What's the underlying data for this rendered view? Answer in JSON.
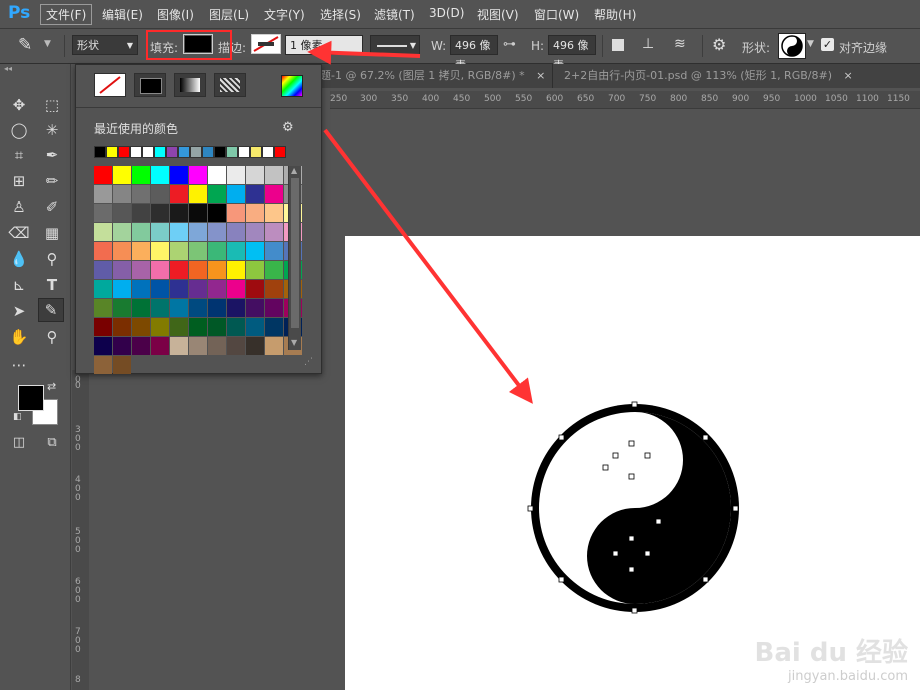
{
  "app": {
    "logo": "Ps"
  },
  "menu": [
    "文件(F)",
    "编辑(E)",
    "图像(I)",
    "图层(L)",
    "文字(Y)",
    "选择(S)",
    "滤镜(T)",
    "3D(D)",
    "视图(V)",
    "窗口(W)",
    "帮助(H)"
  ],
  "options": {
    "mode": "形状",
    "fill_label": "填充:",
    "fill_color": "#000000",
    "stroke_label": "描边:",
    "stroke_width": "1 像素",
    "w_label": "W:",
    "w_value": "496 像素",
    "h_label": "H:",
    "h_value": "496 像素",
    "shape_label": "形状:",
    "align_edges": "对齐边缘"
  },
  "tabs": [
    {
      "label": "题-1 @ 67.2% (图层 1 拷贝, RGB/8#) *",
      "close": "×"
    },
    {
      "label": "2+2自由行-内页-01.psd @ 113% (矩形 1, RGB/8#)",
      "close": "×"
    }
  ],
  "ruler_top": [
    "250",
    "300",
    "350",
    "400",
    "450",
    "500",
    "550",
    "600",
    "650",
    "700",
    "750",
    "800",
    "850",
    "900",
    "950",
    "1000",
    "1050",
    "1100",
    "1150",
    "1200"
  ],
  "ruler_left": [
    "0",
    "3",
    "4",
    "5",
    "6",
    "7",
    "8"
  ],
  "popup": {
    "recent_label": "最近使用的颜色",
    "recent_colors": [
      "#000000",
      "#ffff00",
      "#ff0000",
      "#ffffff",
      "#ffffff",
      "#00ffff",
      "#8e44ad",
      "#3498db",
      "#95a5a6",
      "#2e86c1",
      "#000000",
      "#7fc8a9",
      "#ffffff",
      "#f6e96b",
      "#ffffff",
      "#ff0000"
    ],
    "swatches": [
      "#ff0000",
      "#ffff00",
      "#00ff00",
      "#00ffff",
      "#0000ff",
      "#ff00ff",
      "#ffffff",
      "#ebebeb",
      "#d6d6d6",
      "#c2c2c2",
      "#adadad",
      "#999999",
      "#858585",
      "#707070",
      "#5c5c5c",
      "#ed1c24",
      "#fff200",
      "#00a651",
      "#00aeef",
      "#2e3192",
      "#ec008c",
      "#8c8c8c",
      "#6b6b6b",
      "#575757",
      "#424242",
      "#2e2e2e",
      "#1a1a1a",
      "#0a0a0a",
      "#000000",
      "#f7977a",
      "#f9ad81",
      "#fdc68a",
      "#fff79a",
      "#c4df9b",
      "#a3d39c",
      "#82ca9d",
      "#7bcdc8",
      "#6ecff6",
      "#7ea7d8",
      "#8493ca",
      "#8882be",
      "#a187be",
      "#bc8dbf",
      "#f49ac2",
      "#f26c4f",
      "#f68e55",
      "#fbaf5c",
      "#fff467",
      "#acd372",
      "#7cc576",
      "#3bb878",
      "#1abbb4",
      "#00bff3",
      "#438ccb",
      "#5574b9",
      "#605ca8",
      "#855fa8",
      "#a763a8",
      "#f06eaa",
      "#ed1c24",
      "#f26522",
      "#f7941d",
      "#fff200",
      "#8dc73f",
      "#39b54a",
      "#00a651",
      "#00a99d",
      "#00aeef",
      "#0072bc",
      "#0054a6",
      "#2e3192",
      "#662d91",
      "#92278f",
      "#ec008c",
      "#9e0b0f",
      "#a0410d",
      "#a3620a",
      "#598527",
      "#197b30",
      "#007236",
      "#00746b",
      "#0076a3",
      "#004a80",
      "#003471",
      "#1b1464",
      "#440e62",
      "#630460",
      "#9e005d",
      "#790000",
      "#7b2e00",
      "#7d4900",
      "#827b00",
      "#406618",
      "#005e20",
      "#005826",
      "#005952",
      "#005b7f",
      "#003663",
      "#002157",
      "#0d004c",
      "#32004b",
      "#4b0049",
      "#7b0046",
      "#c7b299",
      "#998675",
      "#736357",
      "#534741",
      "#37302a",
      "#c69c6d",
      "#a67c52",
      "#8c6239",
      "#754c24"
    ]
  },
  "watermark": {
    "brand": "Bai du 经验",
    "url": "jingyan.baidu.com"
  }
}
